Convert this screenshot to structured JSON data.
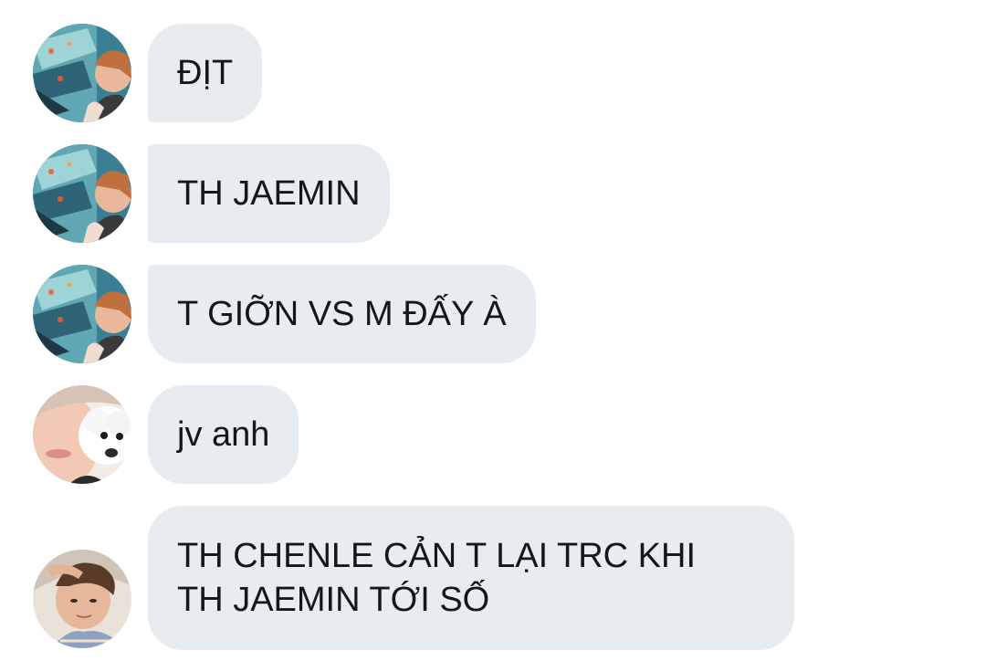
{
  "messages": [
    {
      "sender_avatar": "avatar-aquarium-boy",
      "text": "ĐỊT"
    },
    {
      "sender_avatar": "avatar-aquarium-boy",
      "text": "TH JAEMIN"
    },
    {
      "sender_avatar": "avatar-aquarium-boy",
      "text": "T GIỠN VS M ĐẤY À"
    },
    {
      "sender_avatar": "avatar-boy-with-dog",
      "text": "jv anh"
    },
    {
      "sender_avatar": "avatar-boy-lying-down",
      "lines": [
        "TH CHENLE CẢN T LẠI TRC KHI",
        "TH JAEMIN TỚI SỐ"
      ]
    }
  ],
  "colors": {
    "bubble_bg": "#e6ecf0",
    "text": "#14171a",
    "background": "#ffffff"
  }
}
